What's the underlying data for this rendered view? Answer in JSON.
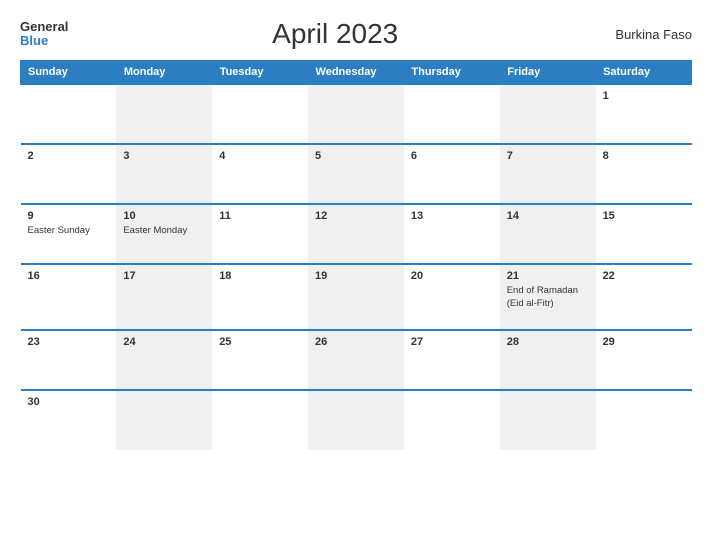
{
  "header": {
    "logo_general": "General",
    "logo_blue": "Blue",
    "title": "April 2023",
    "country": "Burkina Faso"
  },
  "columns": [
    "Sunday",
    "Monday",
    "Tuesday",
    "Wednesday",
    "Thursday",
    "Friday",
    "Saturday"
  ],
  "weeks": [
    [
      {
        "day": "",
        "holiday": "",
        "gray": false
      },
      {
        "day": "",
        "holiday": "",
        "gray": true
      },
      {
        "day": "",
        "holiday": "",
        "gray": false
      },
      {
        "day": "",
        "holiday": "",
        "gray": true
      },
      {
        "day": "",
        "holiday": "",
        "gray": false
      },
      {
        "day": "",
        "holiday": "",
        "gray": true
      },
      {
        "day": "1",
        "holiday": "",
        "gray": false
      }
    ],
    [
      {
        "day": "2",
        "holiday": "",
        "gray": false
      },
      {
        "day": "3",
        "holiday": "",
        "gray": true
      },
      {
        "day": "4",
        "holiday": "",
        "gray": false
      },
      {
        "day": "5",
        "holiday": "",
        "gray": true
      },
      {
        "day": "6",
        "holiday": "",
        "gray": false
      },
      {
        "day": "7",
        "holiday": "",
        "gray": true
      },
      {
        "day": "8",
        "holiday": "",
        "gray": false
      }
    ],
    [
      {
        "day": "9",
        "holiday": "Easter Sunday",
        "gray": false
      },
      {
        "day": "10",
        "holiday": "Easter Monday",
        "gray": true
      },
      {
        "day": "11",
        "holiday": "",
        "gray": false
      },
      {
        "day": "12",
        "holiday": "",
        "gray": true
      },
      {
        "day": "13",
        "holiday": "",
        "gray": false
      },
      {
        "day": "14",
        "holiday": "",
        "gray": true
      },
      {
        "day": "15",
        "holiday": "",
        "gray": false
      }
    ],
    [
      {
        "day": "16",
        "holiday": "",
        "gray": false
      },
      {
        "day": "17",
        "holiday": "",
        "gray": true
      },
      {
        "day": "18",
        "holiday": "",
        "gray": false
      },
      {
        "day": "19",
        "holiday": "",
        "gray": true
      },
      {
        "day": "20",
        "holiday": "",
        "gray": false
      },
      {
        "day": "21",
        "holiday": "End of Ramadan (Eid al-Fitr)",
        "gray": true
      },
      {
        "day": "22",
        "holiday": "",
        "gray": false
      }
    ],
    [
      {
        "day": "23",
        "holiday": "",
        "gray": false
      },
      {
        "day": "24",
        "holiday": "",
        "gray": true
      },
      {
        "day": "25",
        "holiday": "",
        "gray": false
      },
      {
        "day": "26",
        "holiday": "",
        "gray": true
      },
      {
        "day": "27",
        "holiday": "",
        "gray": false
      },
      {
        "day": "28",
        "holiday": "",
        "gray": true
      },
      {
        "day": "29",
        "holiday": "",
        "gray": false
      }
    ],
    [
      {
        "day": "30",
        "holiday": "",
        "gray": false
      },
      {
        "day": "",
        "holiday": "",
        "gray": true
      },
      {
        "day": "",
        "holiday": "",
        "gray": false
      },
      {
        "day": "",
        "holiday": "",
        "gray": true
      },
      {
        "day": "",
        "holiday": "",
        "gray": false
      },
      {
        "day": "",
        "holiday": "",
        "gray": true
      },
      {
        "day": "",
        "holiday": "",
        "gray": false
      }
    ]
  ]
}
